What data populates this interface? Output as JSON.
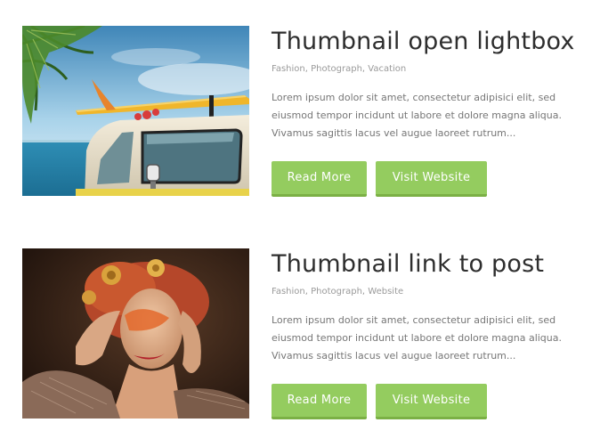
{
  "posts": [
    {
      "title": "Thumbnail open lightbox",
      "tags": [
        "Fashion",
        "Photograph",
        "Vacation"
      ],
      "excerpt": "Lorem ipsum dolor sit amet, consectetur adipisici elit, sed eiusmod tempor incidunt ut labore et dolore magna aliqua. Vivamus sagittis lacus vel augue laoreet rutrum...",
      "read_more_label": "Read More",
      "visit_label": "Visit Website",
      "thumbnail_icon": "beach-van-photo"
    },
    {
      "title": "Thumbnail link to post",
      "tags": [
        "Fashion",
        "Photograph",
        "Website"
      ],
      "excerpt": "Lorem ipsum dolor sit amet, consectetur adipisici elit, sed eiusmod tempor incidunt ut labore et dolore magna aliqua. Vivamus sagittis lacus vel augue laoreet rutrum...",
      "read_more_label": "Read More",
      "visit_label": "Visit Website",
      "thumbnail_icon": "fashion-portrait-photo"
    }
  ],
  "colors": {
    "button_bg": "#94cc5f",
    "button_shadow": "#7bb045",
    "title": "#2e2e2e",
    "meta": "#9a9a9a",
    "body_text": "#767676"
  }
}
